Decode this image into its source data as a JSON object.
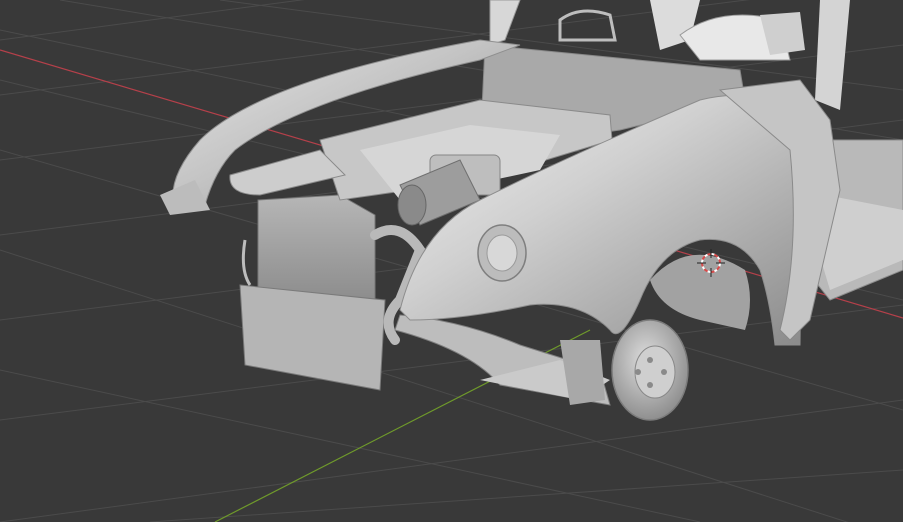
{
  "viewport": {
    "background_color": "#393939",
    "grid_color": "#4a4a4a",
    "x_axis_color": "#c0444f",
    "y_axis_color": "#6f9a2b",
    "model_color": "#c9c9c9",
    "model_shadow_color": "#8d8d8d",
    "cursor_color": "#d84a4a"
  },
  "scene": {
    "object_description_icon": "3d-car-chassis-model",
    "cursor_icon": "3d-cursor-icon"
  }
}
